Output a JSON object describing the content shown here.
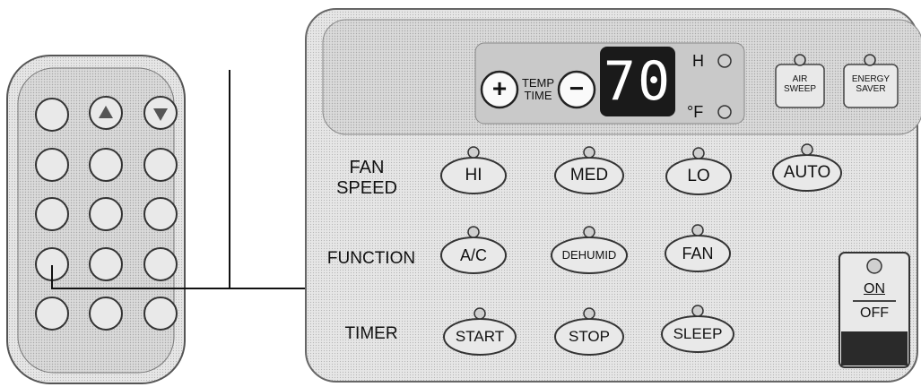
{
  "remote": {
    "top_labels": [
      "",
      "",
      ""
    ],
    "row_labels": [
      "",
      "",
      "",
      "",
      ""
    ]
  },
  "panel": {
    "temp_plus": "+",
    "temp_label_line1": "TEMP",
    "temp_label_line2": "TIME",
    "temp_minus": "−",
    "display_value": "70",
    "indicator_h": "H",
    "indicator_f": "°F",
    "air_sweep_line1": "AIR",
    "air_sweep_line2": "SWEEP",
    "energy_saver_line1": "ENERGY",
    "energy_saver_line2": "SAVER",
    "fan_speed_line1": "FAN",
    "fan_speed_line2": "SPEED",
    "fan_buttons": [
      "HI",
      "MED",
      "LO",
      "AUTO"
    ],
    "function_label": "FUNCTION",
    "function_buttons": [
      "A/C",
      "DEHUMID",
      "FAN"
    ],
    "timer_label": "TIMER",
    "timer_buttons": [
      "START",
      "STOP",
      "SLEEP"
    ],
    "power_on": "ON",
    "power_off": "OFF"
  },
  "colors": {
    "panel_fill": "#e4e4e4",
    "display_bg": "#1a1a1a",
    "display_text": "#ffffff",
    "power_dark": "#2a2a2a"
  }
}
